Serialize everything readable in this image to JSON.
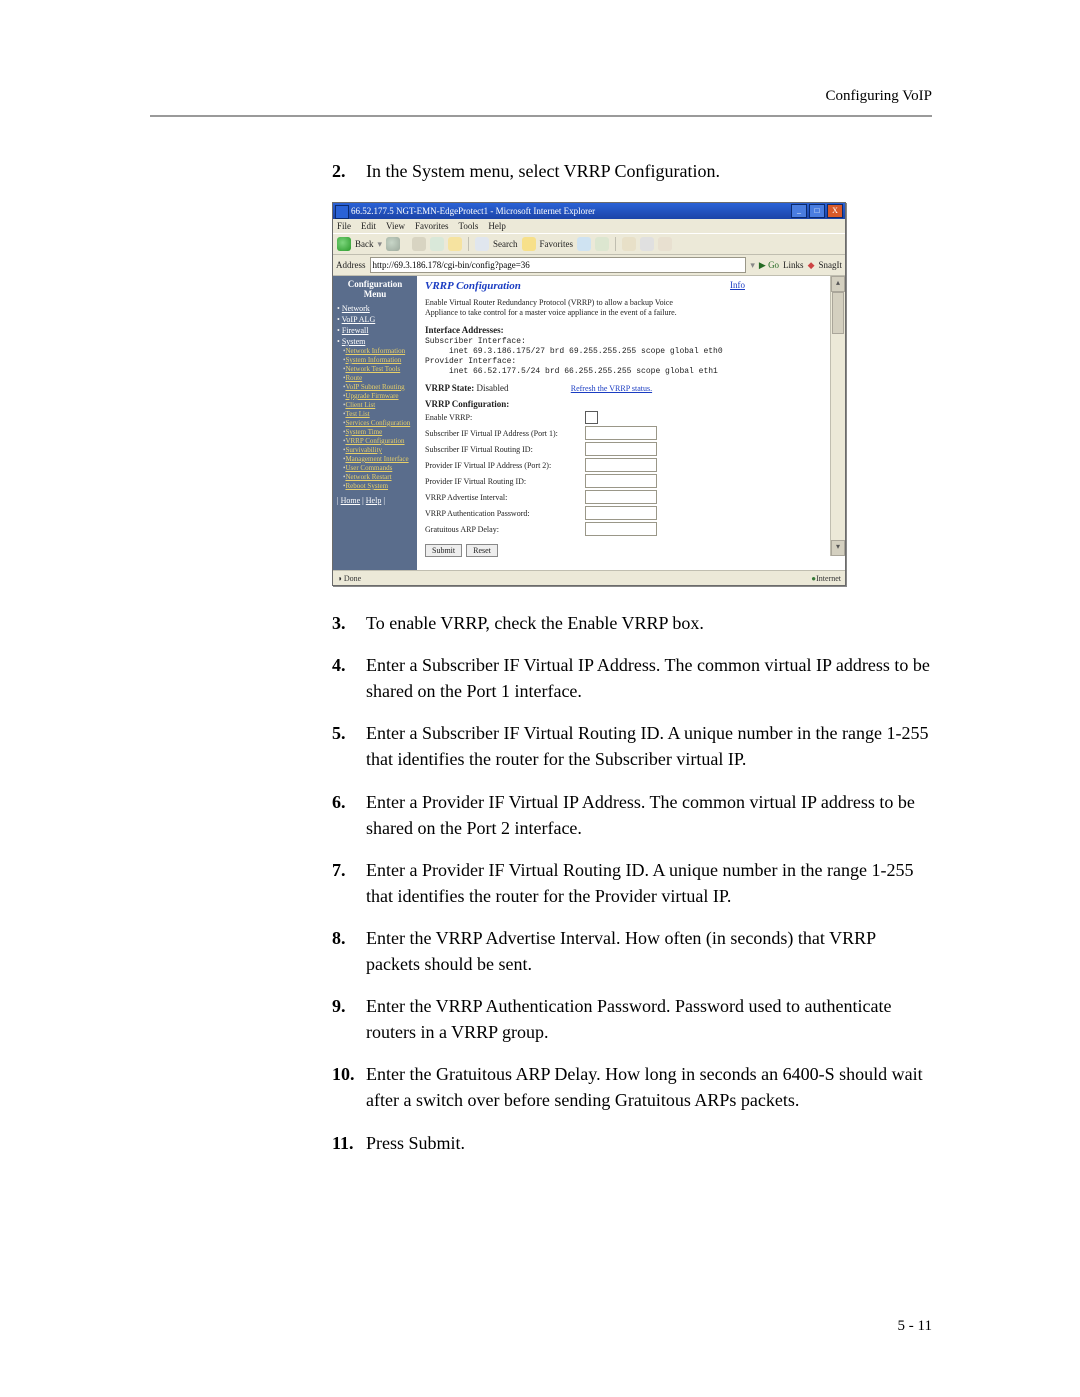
{
  "header": {
    "running": "Configuring VoIP"
  },
  "footer": {
    "pagenum": "5 - 11"
  },
  "steps": [
    {
      "num": "2.",
      "text": "In the System menu, select VRRP Configuration."
    },
    {
      "num": "3.",
      "text": "To enable VRRP, check the Enable VRRP box."
    },
    {
      "num": "4.",
      "text": "Enter a Subscriber IF Virtual IP Address. The common virtual IP address to be shared on the Port 1 interface."
    },
    {
      "num": "5.",
      "text": "Enter a Subscriber IF Virtual Routing ID. A unique number in the range 1-255 that identifies the router for the Subscriber virtual IP."
    },
    {
      "num": "6.",
      "text": "Enter a Provider IF Virtual IP Address. The common virtual IP address to be shared on the Port 2 interface."
    },
    {
      "num": "7.",
      "text": "Enter a Provider IF Virtual Routing ID. A unique number in the range 1-255 that identifies the router for the Provider virtual IP."
    },
    {
      "num": "8.",
      "text": "Enter the VRRP Advertise Interval. How often (in seconds) that VRRP packets should be sent."
    },
    {
      "num": "9.",
      "text": "Enter the VRRP Authentication Password. Password used to authenticate routers in a VRRP group."
    },
    {
      "num": "10.",
      "text": "Enter the Gratuitous ARP Delay. How long in seconds an 6400-S should wait after a switch over before sending Gratuitous ARPs packets."
    },
    {
      "num": "11.",
      "text": "Press Submit."
    }
  ],
  "screenshot": {
    "title": "66.52.177.5 NGT-EMN-EdgeProtect1 - Microsoft Internet Explorer",
    "winbtns": {
      "min": "_",
      "max": "□",
      "close": "X"
    },
    "menu": [
      "File",
      "Edit",
      "View",
      "Favorites",
      "Tools",
      "Help"
    ],
    "toolbar": {
      "back": "Back",
      "search": "Search",
      "favorites": "Favorites"
    },
    "address": {
      "label": "Address",
      "url": "http://69.3.186.178/cgi-bin/config?page=36",
      "go": "Go",
      "links": "Links",
      "snag": "SnagIt"
    },
    "sidebar": {
      "header": "Configuration Menu",
      "top": [
        {
          "label": "Network"
        },
        {
          "label": "VoIP ALG"
        },
        {
          "label": "Firewall"
        },
        {
          "label": "System"
        }
      ],
      "system_sub": [
        "Network Information",
        "System Information",
        "Network Test Tools",
        "Route",
        "VoIP Subnet Routing",
        "Upgrade Firmware",
        "Client List",
        "Test List",
        "Services Configuration",
        "System Time",
        "VRRP Configuration",
        "Survivability",
        "Management Interface",
        "User Commands",
        "Network Restart",
        "Reboot System"
      ],
      "footer": {
        "home": "Home",
        "help": "Help"
      }
    },
    "pane": {
      "title": "VRRP Configuration",
      "info": "Info",
      "intro": "Enable Virtual Router Redundancy Protocol (VRRP) to allow a backup Voice Appliance to take control for a master voice appliance in the event of a failure.",
      "ifhdr": "Interface Addresses:",
      "ifblock": "Subscriber Interface:\n     inet 69.3.186.175/27 brd 69.255.255.255 scope global eth0\nProvider Interface:\n     inet 66.52.177.5/24 brd 66.255.255.255 scope global eth1",
      "state_label": "VRRP State:",
      "state_value": "Disabled",
      "refresh": "Refresh the VRRP status.",
      "cfg_hdr": "VRRP Configuration:",
      "fields": {
        "enable": "Enable VRRP:",
        "sub_ip": "Subscriber IF Virtual IP Address (Port 1):",
        "sub_id": "Subscriber IF Virtual Routing ID:",
        "prov_ip": "Provider IF Virtual IP Address (Port 2):",
        "prov_id": "Provider IF Virtual Routing ID:",
        "adv": "VRRP Advertise Interval:",
        "auth": "VRRP Authentication Password:",
        "garp": "Gratuitous ARP Delay:"
      },
      "buttons": {
        "submit": "Submit",
        "reset": "Reset"
      }
    },
    "status": {
      "done": "Done",
      "inet": "Internet"
    }
  }
}
